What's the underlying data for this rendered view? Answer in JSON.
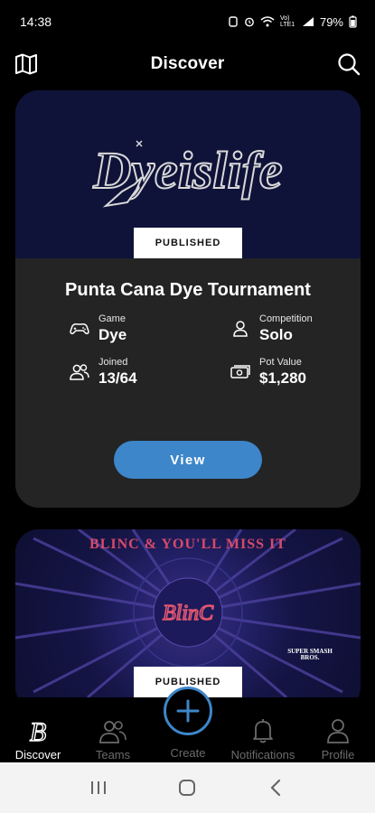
{
  "status_bar": {
    "time": "14:38",
    "battery": "79%",
    "network_label": "Vo) LTE1"
  },
  "header": {
    "title": "Discover"
  },
  "cards": [
    {
      "banner_text": "Dyeislife",
      "badge": "PUBLISHED",
      "title": "Punta Cana Dye Tournament",
      "stats": [
        {
          "label": "Game",
          "value": "Dye",
          "icon": "gamepad-icon"
        },
        {
          "label": "Competition",
          "value": "Solo",
          "icon": "person-icon"
        },
        {
          "label": "Joined",
          "value": "13/64",
          "icon": "people-icon"
        },
        {
          "label": "Pot Value",
          "value": "$1,280",
          "icon": "cash-icon"
        }
      ],
      "button": "View"
    },
    {
      "banner_headline": "BLINC & YOU'LL MISS IT",
      "banner_logo": "BlinC",
      "banner_sublogo": "SUPER SMASH BROS.",
      "badge": "PUBLISHED"
    }
  ],
  "bottom_nav": [
    {
      "label": "Discover",
      "icon": "discover-b-icon",
      "active": true
    },
    {
      "label": "Teams",
      "icon": "teams-icon",
      "active": false
    },
    {
      "label": "Create",
      "icon": "plus-icon",
      "active": false
    },
    {
      "label": "Notifications",
      "icon": "bell-icon",
      "active": false
    },
    {
      "label": "Profile",
      "icon": "profile-icon",
      "active": false
    }
  ],
  "colors": {
    "background": "#000000",
    "card": "#242424",
    "accent": "#3d86c9",
    "banner_navy": "#0f1339",
    "blinc_pink": "#d94a6a"
  }
}
